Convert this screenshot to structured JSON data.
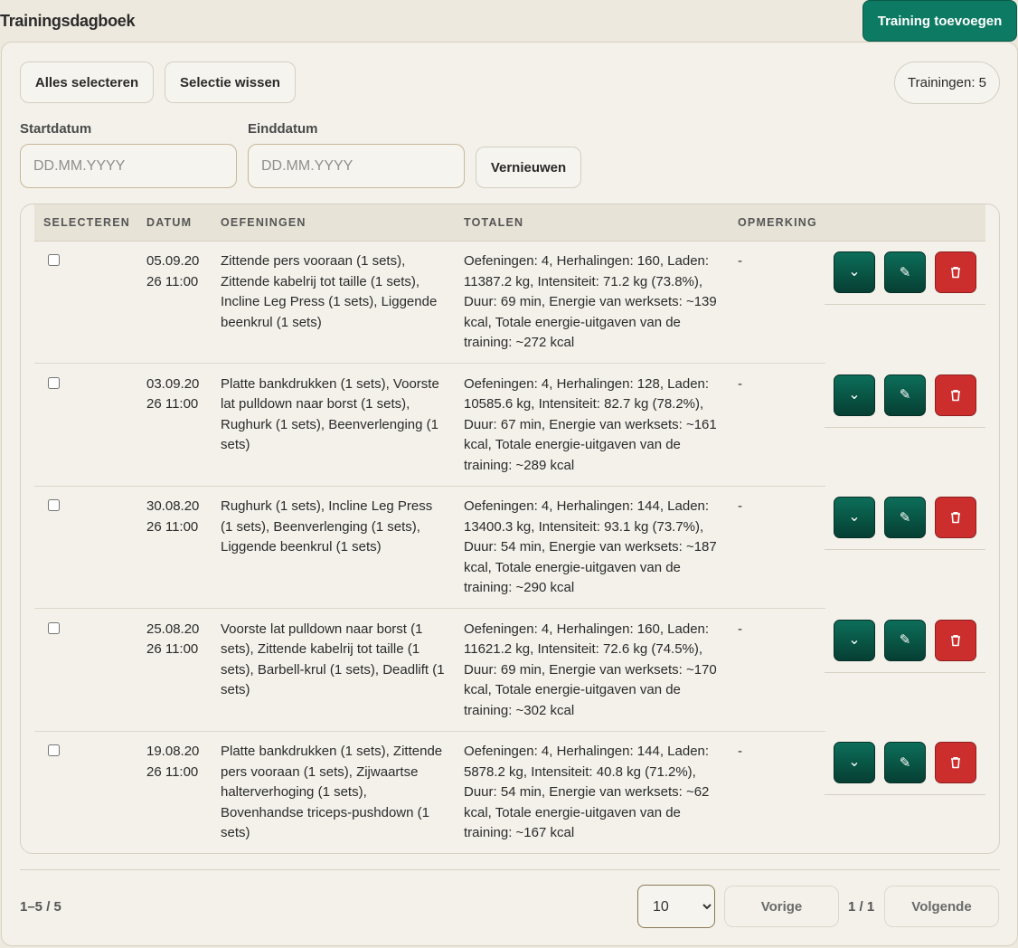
{
  "header": {
    "title": "Trainingsdagboek",
    "add_label": "Training toevoegen"
  },
  "toolbar": {
    "select_all": "Alles selecteren",
    "clear_selection": "Selectie wissen",
    "count": "Trainingen: 5"
  },
  "filters": {
    "start_label": "Startdatum",
    "start_placeholder": "DD.MM.YYYY",
    "end_label": "Einddatum",
    "end_placeholder": "DD.MM.YYYY",
    "refresh": "Vernieuwen"
  },
  "table": {
    "headers": [
      "SELECTEREN",
      "DATUM",
      "OEFENINGEN",
      "TOTALEN",
      "OPMERKING"
    ],
    "rows": [
      {
        "date1": "05.09.20",
        "date2": "26 11:00",
        "exercises": [
          "Zittende pers vooraan (1 sets),",
          "Zittende kabelrij tot taille (1 sets),",
          "Incline Leg Press (1 sets), Liggende",
          "beenkrul (1 sets)"
        ],
        "totals": [
          "Oefeningen: 4, Herhalingen: 160, Laden:",
          "11387.2 kg, Intensiteit: 71.2 kg (73.8%),",
          "Duur: 69 min, Energie van werksets: ~139",
          "kcal, Totale energie-uitgaven van de",
          "training: ~272 kcal"
        ],
        "note": "-"
      },
      {
        "date1": "03.09.20",
        "date2": "26 11:00",
        "exercises": [
          "Platte bankdrukken (1 sets), Voorste",
          "lat pulldown naar borst (1 sets),",
          "Rughurk (1 sets), Beenverlenging (1",
          "sets)"
        ],
        "totals": [
          "Oefeningen: 4, Herhalingen: 128, Laden:",
          "10585.6 kg, Intensiteit: 82.7 kg (78.2%),",
          "Duur: 67 min, Energie van werksets: ~161",
          "kcal, Totale energie-uitgaven van de",
          "training: ~289 kcal"
        ],
        "note": "-"
      },
      {
        "date1": "30.08.20",
        "date2": "26 11:00",
        "exercises": [
          "Rughurk (1 sets), Incline Leg Press",
          "(1 sets), Beenverlenging (1 sets),",
          "Liggende beenkrul (1 sets)"
        ],
        "totals": [
          "Oefeningen: 4, Herhalingen: 144, Laden:",
          "13400.3 kg, Intensiteit: 93.1 kg (73.7%),",
          "Duur: 54 min, Energie van werksets: ~187",
          "kcal, Totale energie-uitgaven van de",
          "training: ~290 kcal"
        ],
        "note": "-"
      },
      {
        "date1": "25.08.20",
        "date2": "26 11:00",
        "exercises": [
          "Voorste lat pulldown naar borst (1",
          "sets), Zittende kabelrij tot taille (1",
          "sets), Barbell-krul (1 sets), Deadlift (1",
          "sets)"
        ],
        "totals": [
          "Oefeningen: 4, Herhalingen: 160, Laden:",
          "11621.2 kg, Intensiteit: 72.6 kg (74.5%),",
          "Duur: 69 min, Energie van werksets: ~170",
          "kcal, Totale energie-uitgaven van de",
          "training: ~302 kcal"
        ],
        "note": "-"
      },
      {
        "date1": "19.08.20",
        "date2": "26 11:00",
        "exercises": [
          "Platte bankdrukken (1 sets), Zittende",
          "pers vooraan (1 sets), Zijwaartse",
          "halterverhoging (1 sets),",
          "Bovenhandse triceps-pushdown (1",
          "sets)"
        ],
        "totals": [
          "Oefeningen: 4, Herhalingen: 144, Laden:",
          "5878.2 kg, Intensiteit: 40.8 kg (71.2%),",
          "Duur: 54 min, Energie van werksets: ~62",
          "kcal, Totale energie-uitgaven van de",
          "training: ~167 kcal"
        ],
        "note": "-"
      }
    ],
    "action_icons": {
      "expand": "⌄",
      "edit": "✎",
      "delete": "trash-icon"
    }
  },
  "footer": {
    "range": "1–5 / 5",
    "page_size": "10",
    "page_size_options": [
      "10"
    ],
    "prev": "Vorige",
    "page": "1 / 1",
    "next": "Volgende"
  },
  "colors": {
    "accent": "#0d7a63",
    "danger": "#cc2e2e",
    "background": "#ede9de"
  }
}
